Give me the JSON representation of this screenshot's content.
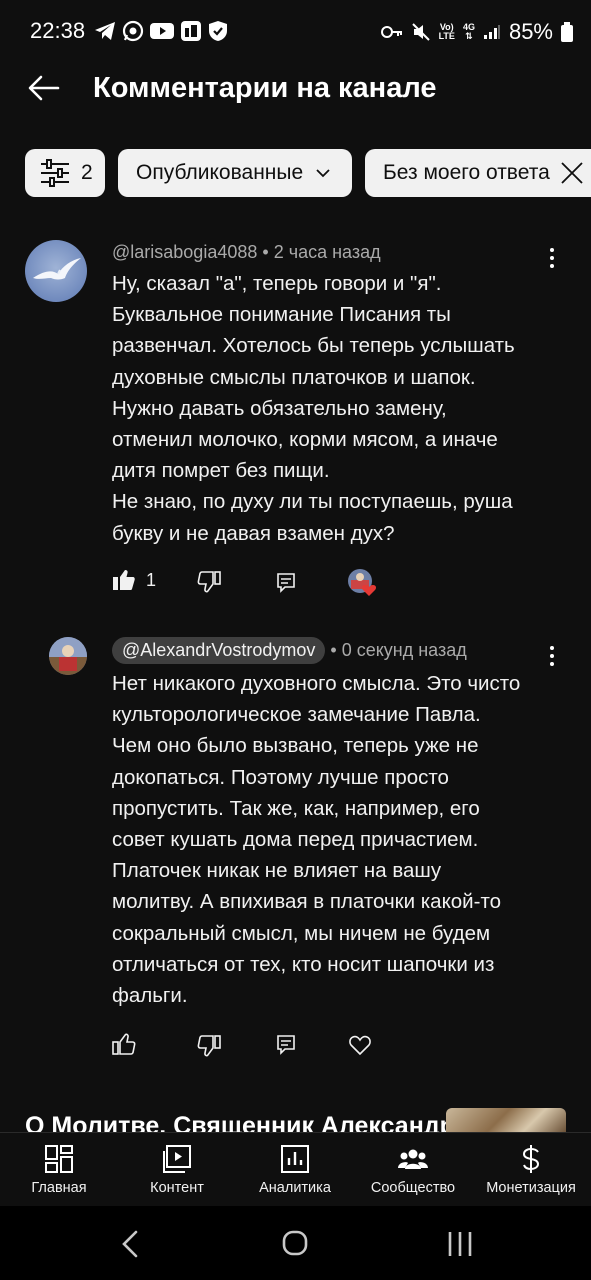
{
  "status_bar": {
    "time": "22:38",
    "battery": "85%",
    "left_icons": [
      "telegram-icon",
      "whatsapp-icon",
      "youtube-icon",
      "yt-studio-icon",
      "shield-icon"
    ],
    "right_icons": [
      "key-icon",
      "mute-icon",
      "volte-icon",
      "4g-icon",
      "signal-icon",
      "battery-icon"
    ],
    "volte_top": "Vo)",
    "volte_bottom": "LTE",
    "net_top": "4G"
  },
  "header": {
    "title": "Комментарии на канале"
  },
  "chips": {
    "filter_count": "2",
    "published_label": "Опубликованные",
    "no_reply_label": "Без моего ответа"
  },
  "comment1": {
    "author": "@larisabogia4088",
    "time": "2 часа назад",
    "text": "Ну, сказал \"а\", теперь говори и \"я\".\nБуквальное понимание Писания ты\nразвенчал. Хотелось бы теперь услышать\nдуховные смыслы платочков и шапок.\nНужно давать обязательно замену,\nотменил молочко, корми мясом, а иначе\nдитя помрет без пищи.\nНе знаю, по духу ли ты поступаешь, руша\nбукву и не давая взамен дух?",
    "likes": "1"
  },
  "reply1": {
    "author": "@AlexandrVostrodymov",
    "time": "0 секунд назад",
    "text": "Нет никакого духовного смысла. Это чисто\nкульторологическое замечание Павла.\nЧем оно было вызвано, теперь уже не\nдокопаться. Поэтому лучше просто\nпропустить. Так же, как, например, его\nсовет кушать дома перед причастием.\nПлаточек никак не влияет на вашу\nмолитву. А впихивая в платочки какой-то\nсокральный смысл, мы ничем не будем\nотличаться от тех, кто носит шапочки из\nфальги."
  },
  "video": {
    "title": "О Молитве. Священник Александр"
  },
  "bottom_nav": {
    "items": [
      {
        "label": "Главная",
        "icon": "dashboard-icon"
      },
      {
        "label": "Контент",
        "icon": "content-icon"
      },
      {
        "label": "Аналитика",
        "icon": "analytics-icon"
      },
      {
        "label": "Сообщество",
        "icon": "community-icon"
      },
      {
        "label": "Монетизация",
        "icon": "dollar-icon"
      }
    ]
  },
  "colors": {
    "background": "#0f0f0f",
    "chip_bg": "#f1f1f1",
    "meta_text": "#aaaaaa",
    "like_heart": "#e53935"
  }
}
